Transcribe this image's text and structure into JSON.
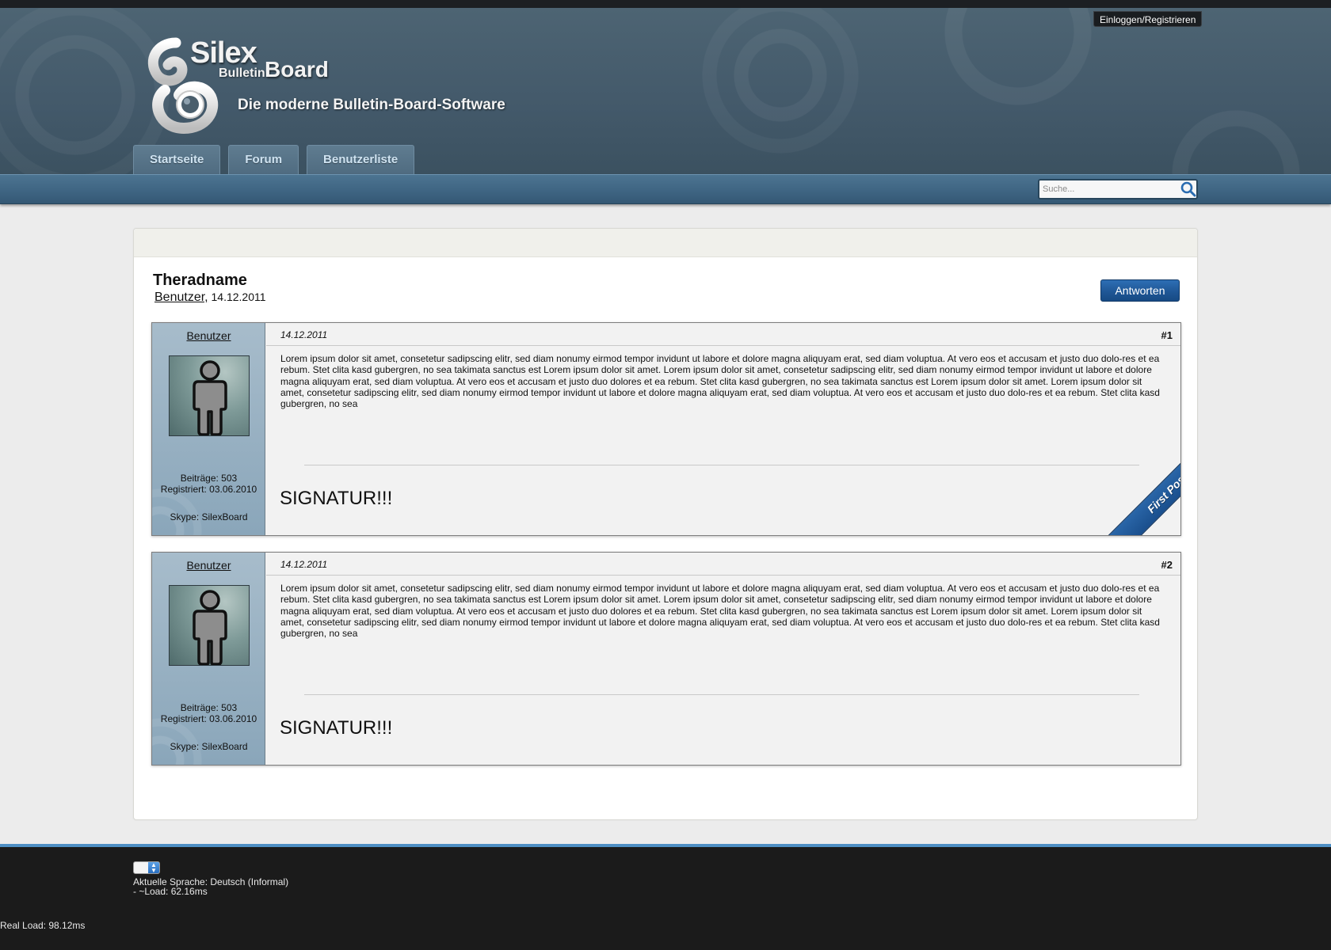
{
  "header": {
    "login_label": "Einloggen/Registrieren",
    "logo": {
      "silex": "Silex",
      "bulletin": "Bulletin",
      "board": "Board"
    },
    "tagline": "Die moderne Bulletin-Board-Software",
    "nav": [
      {
        "label": "Startseite"
      },
      {
        "label": "Forum"
      },
      {
        "label": "Benutzerliste"
      }
    ],
    "search": {
      "placeholder": "Suche...",
      "icon": "search-icon"
    }
  },
  "thread": {
    "title": "Theradname",
    "author": "Benutzer,",
    "date": "14.12.2011",
    "reply_label": "Antworten"
  },
  "posts": [
    {
      "username": "Benutzer",
      "posts_count": "Beiträge: 503",
      "registered": "Registriert: 03.06.2010",
      "skype": "Skype: SilexBoard",
      "date": "14.12.2011",
      "number": "#1",
      "body": "Lorem ipsum dolor sit amet, consetetur sadipscing elitr, sed diam nonumy eirmod tempor invidunt ut labore et dolore magna aliquyam erat, sed diam voluptua. At vero eos et accusam et justo duo dolo-res et ea rebum. Stet clita kasd gubergren, no sea takimata sanctus est Lorem ipsum dolor sit amet. Lorem ipsum dolor sit amet, consetetur sadipscing elitr, sed diam nonumy eirmod tempor invidunt ut labore et dolore magna aliquyam erat, sed diam voluptua. At vero eos et accusam et justo duo dolores et ea rebum. Stet clita kasd gubergren, no sea takimata sanctus est Lorem ipsum dolor sit amet. Lorem ipsum dolor sit amet, consetetur sadipscing elitr, sed diam nonumy eirmod tempor invidunt ut labore et dolore magna aliquyam erat, sed diam voluptua. At vero eos et accusam et justo duo dolo-res et ea rebum. Stet clita kasd gubergren, no sea",
      "signature": "SIGNATUR!!!",
      "ribbon": "First Post!"
    },
    {
      "username": "Benutzer",
      "posts_count": "Beiträge: 503",
      "registered": "Registriert: 03.06.2010",
      "skype": "Skype: SilexBoard",
      "date": "14.12.2011",
      "number": "#2",
      "body": "Lorem ipsum dolor sit amet, consetetur sadipscing elitr, sed diam nonumy eirmod tempor invidunt ut labore et dolore magna aliquyam erat, sed diam voluptua. At vero eos et accusam et justo duo dolo-res et ea rebum. Stet clita kasd gubergren, no sea takimata sanctus est Lorem ipsum dolor sit amet. Lorem ipsum dolor sit amet, consetetur sadipscing elitr, sed diam nonumy eirmod tempor invidunt ut labore et dolore magna aliquyam erat, sed diam voluptua. At vero eos et accusam et justo duo dolores et ea rebum. Stet clita kasd gubergren, no sea takimata sanctus est Lorem ipsum dolor sit amet. Lorem ipsum dolor sit amet, consetetur sadipscing elitr, sed diam nonumy eirmod tempor invidunt ut labore et dolore magna aliquyam erat, sed diam voluptua. At vero eos et accusam et justo duo dolo-res et ea rebum. Stet clita kasd gubergren, no sea",
      "signature": "SIGNATUR!!!"
    }
  ],
  "footer": {
    "language": "Aktuelle Sprache: Deutsch (Informal)",
    "load": "- ~Load: 62.16ms",
    "real_load": "Real Load: 98.12ms"
  },
  "colors": {
    "header_bg": "#43596a",
    "navbar": "#3f6583",
    "reply_button": "#1f5796",
    "ribbon": "#1a4f8d",
    "footer_bg": "#1b1b1b",
    "footer_accent": "#4e8fc4"
  }
}
